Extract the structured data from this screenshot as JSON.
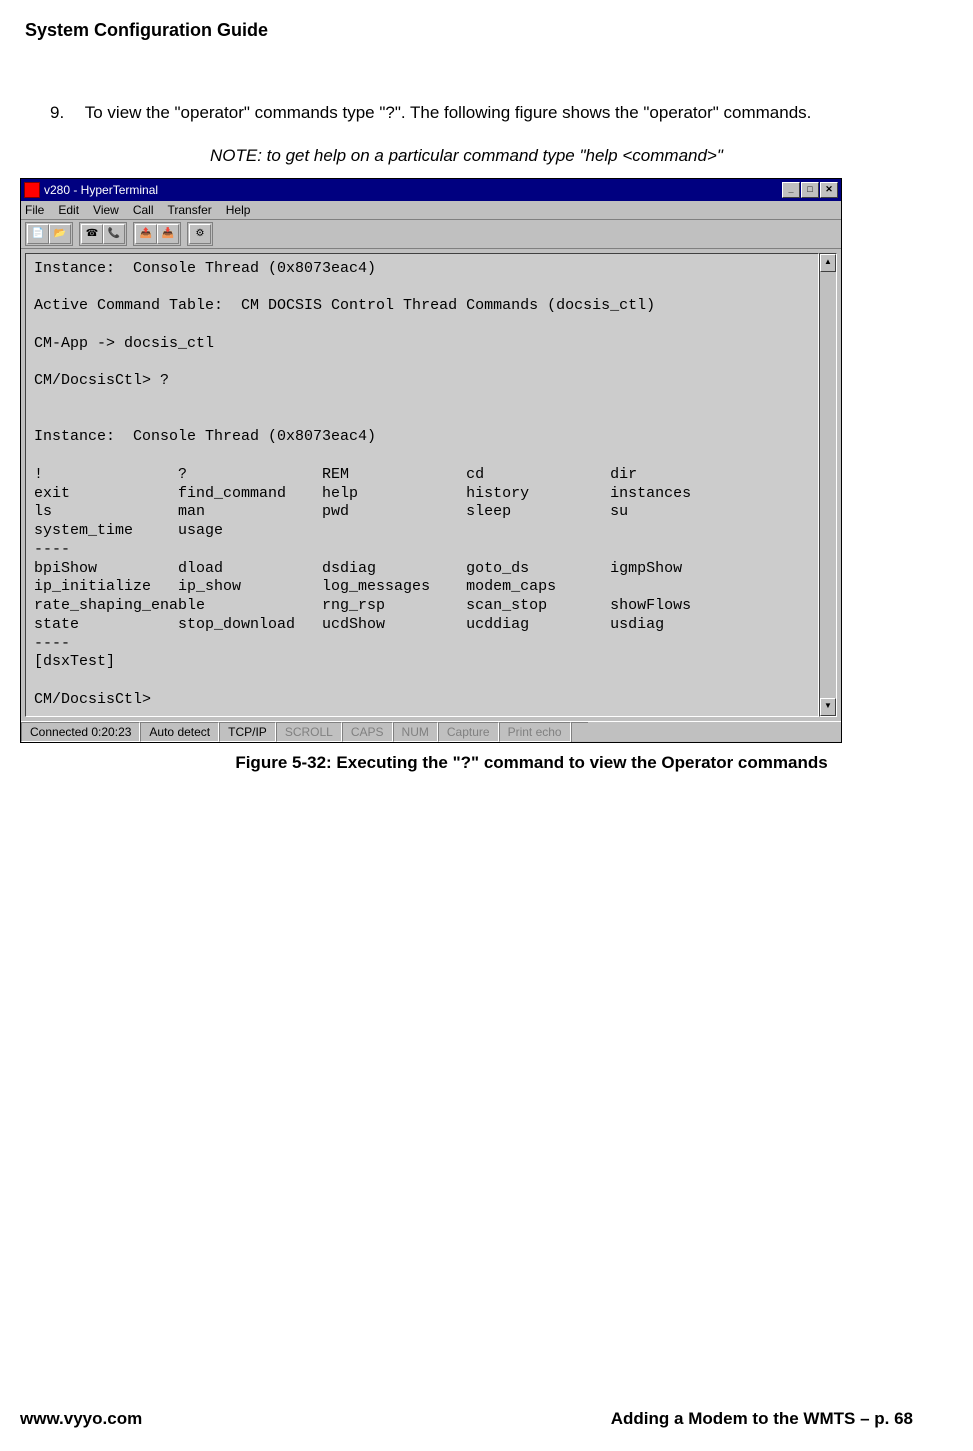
{
  "header": {
    "title": "System Configuration Guide"
  },
  "step": {
    "number": "9.",
    "text": "To view the \"operator\" commands type \"?\".  The following figure shows the \"operator\" commands."
  },
  "note": "NOTE: to get help on a particular command type \"help <command>\"",
  "window": {
    "title": "v280 - HyperTerminal",
    "menu": [
      "File",
      "Edit",
      "View",
      "Call",
      "Transfer",
      "Help"
    ],
    "controls": {
      "min": "_",
      "max": "□",
      "close": "✕"
    }
  },
  "terminal_text": "Instance:  Console Thread (0x8073eac4)\n\nActive Command Table:  CM DOCSIS Control Thread Commands (docsis_ctl)\n\nCM-App -> docsis_ctl\n\nCM/DocsisCtl> ?\n\n\nInstance:  Console Thread (0x8073eac4)\n\n!               ?               REM             cd              dir\nexit            find_command    help            history         instances\nls              man             pwd             sleep           su\nsystem_time     usage\n----\nbpiShow         dload           dsdiag          goto_ds         igmpShow\nip_initialize   ip_show         log_messages    modem_caps\nrate_shaping_enable             rng_rsp         scan_stop       showFlows\nstate           stop_download   ucdShow         ucddiag         usdiag\n----\n[dsxTest]\n\nCM/DocsisCtl>",
  "statusbar": {
    "connected": "Connected 0:20:23",
    "detect": "Auto detect",
    "proto": "TCP/IP",
    "scroll": "SCROLL",
    "caps": "CAPS",
    "num": "NUM",
    "capture": "Capture",
    "echo": "Print echo"
  },
  "figure_caption": "Figure 5-32:  Executing the \"?\" command to view the Operator commands",
  "footer": {
    "left": "www.vyyo.com",
    "right": "Adding a Modem to the WMTS – p. 68"
  }
}
